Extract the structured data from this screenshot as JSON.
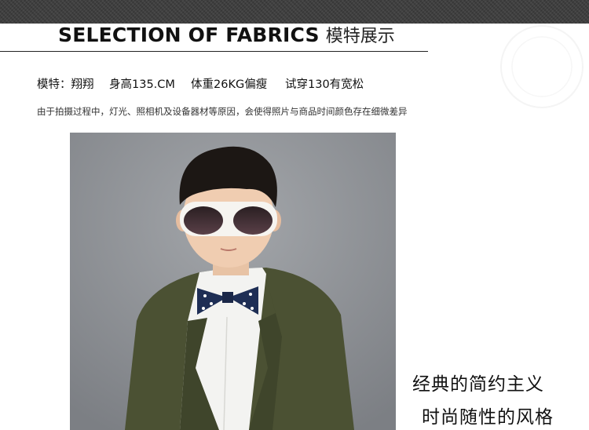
{
  "header": {
    "title_en": "SELECTION OF FABRICS",
    "title_cn": "模特展示"
  },
  "model_info": {
    "name": "模特：翔翔",
    "height": "身高135.CM",
    "weight": "体重26KG偏瘦",
    "fit": "试穿130有宽松"
  },
  "notice": "由于拍摄过程中，灯光、照相机及设备器材等原因，会使得照片与商品时间颜色存在细微差异",
  "slogan": {
    "line1": "经典的简约主义",
    "line2": "时尚随性的风格"
  },
  "colors": {
    "band": "#3f3f3f",
    "photo_background": "#8e9196",
    "jacket": "#4b5133"
  }
}
